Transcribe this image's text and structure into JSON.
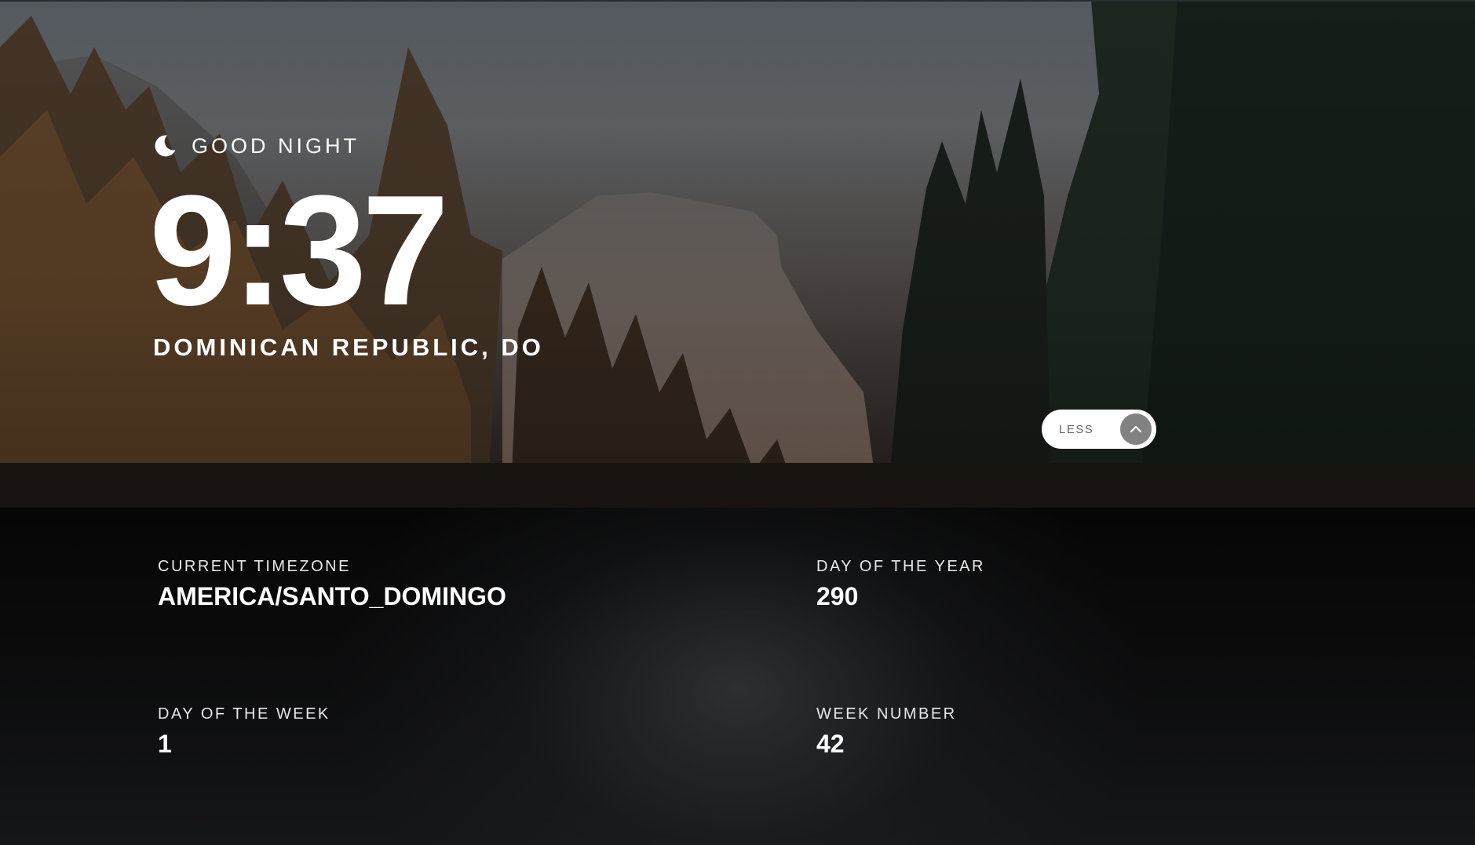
{
  "greeting": {
    "icon": "moon-icon",
    "text": "GOOD NIGHT"
  },
  "clock": {
    "time": "9:37"
  },
  "location": {
    "text": "DOMINICAN REPUBLIC, DO"
  },
  "toggle": {
    "label": "LESS",
    "icon": "chevron-up-icon"
  },
  "details": {
    "timezone": {
      "label": "CURRENT TIMEZONE",
      "value": "AMERICA/SANTO_DOMINGO"
    },
    "day_of_year": {
      "label": "DAY OF THE YEAR",
      "value": "290"
    },
    "day_of_week": {
      "label": "DAY OF THE WEEK",
      "value": "1"
    },
    "week_number": {
      "label": "WEEK NUMBER",
      "value": "42"
    }
  },
  "colors": {
    "panel_background": "#0c0c0d",
    "text": "#ffffff",
    "toggle_background": "#ffffff",
    "toggle_label": "#666666",
    "chevron_circle": "#303030"
  }
}
